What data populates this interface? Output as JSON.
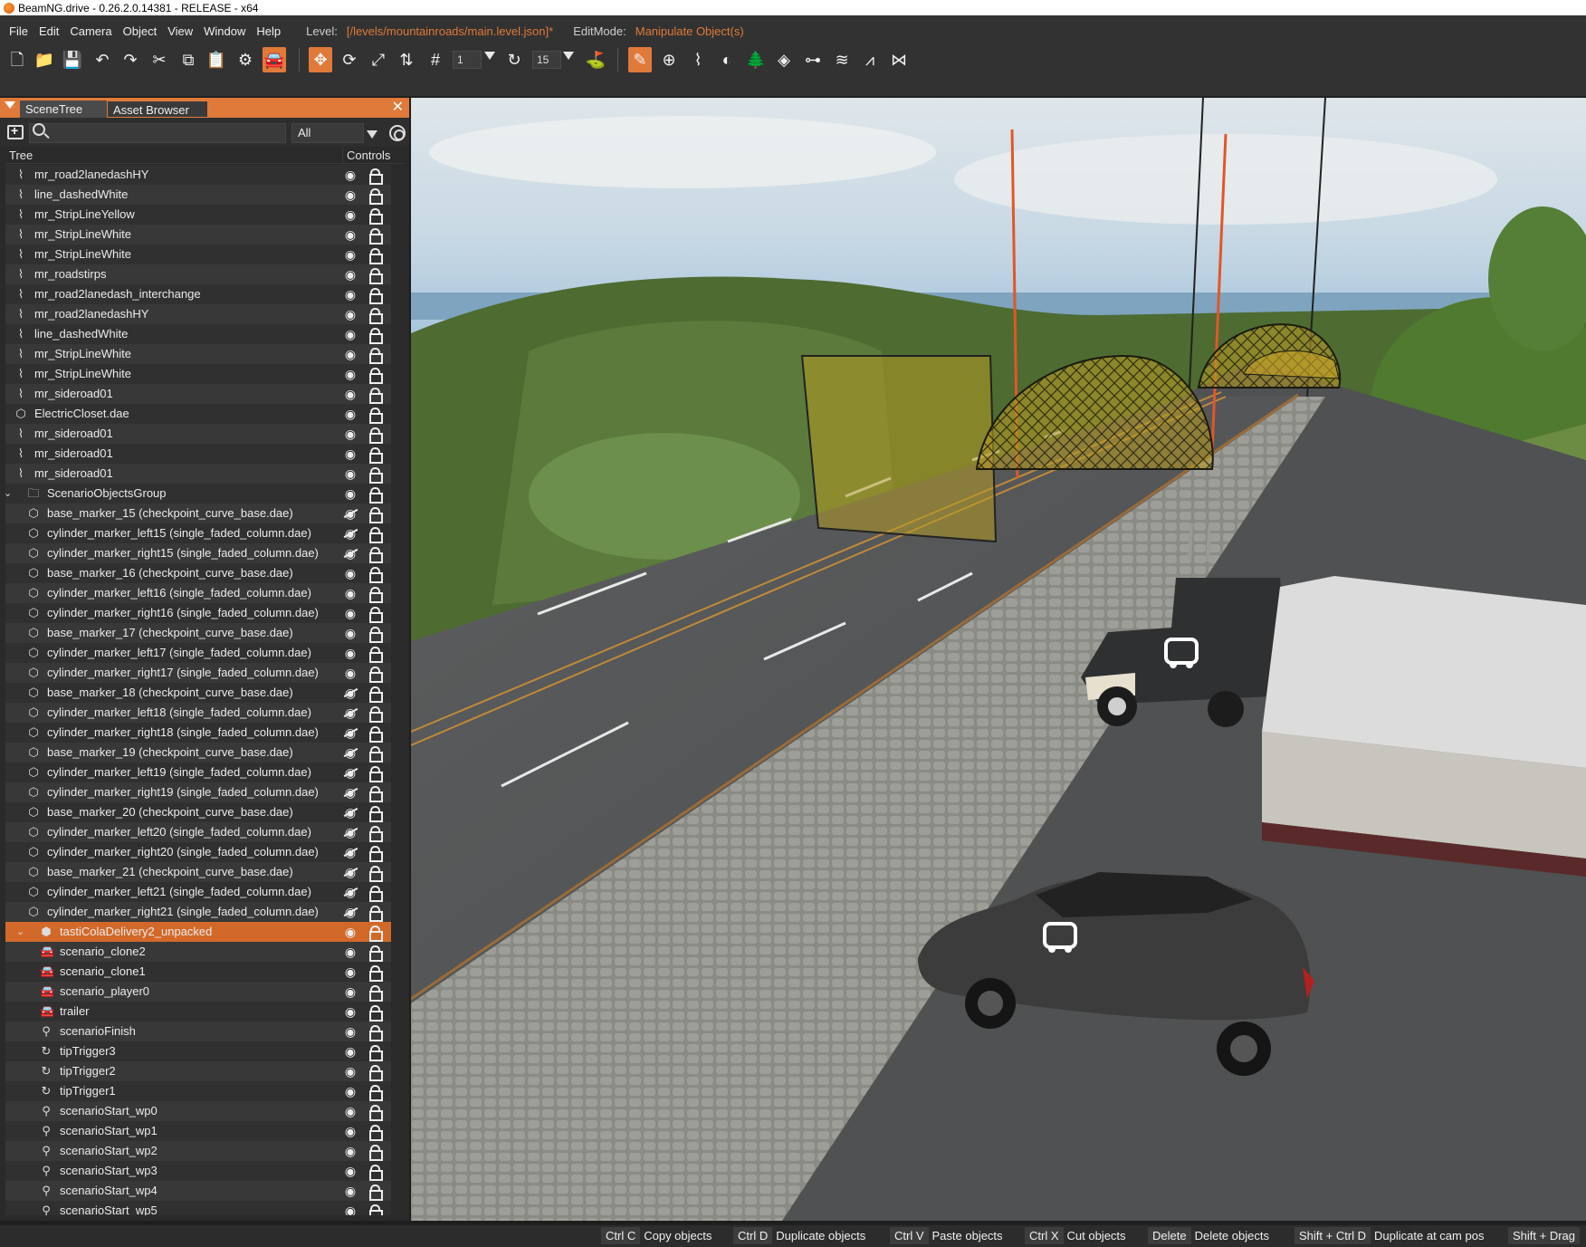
{
  "window": {
    "title": "BeamNG.drive - 0.26.2.0.14381 - RELEASE - x64"
  },
  "menu": {
    "items": [
      "File",
      "Edit",
      "Camera",
      "Object",
      "View",
      "Window",
      "Help"
    ],
    "level_label": "Level:",
    "level_value": "[/levels/mountainroads/main.level.json]*",
    "editmode_label": "EditMode:",
    "editmode_value": "Manipulate Object(s)"
  },
  "toolbar": {
    "grid_value": "1",
    "rotation_snap_value": "15",
    "accent_color": "#e07a3a"
  },
  "panel": {
    "tabs": [
      "SceneTree",
      "Asset Browser"
    ],
    "search": {
      "placeholder": "",
      "value": ""
    },
    "filter_value": "All",
    "header_tree": "Tree",
    "header_controls": "Controls"
  },
  "tree_rows": [
    {
      "label": "mr_road2lanedashHY",
      "icon": "road-icon",
      "hidden": false
    },
    {
      "label": "line_dashedWhite",
      "icon": "road-icon",
      "hidden": false
    },
    {
      "label": "mr_StripLineYellow",
      "icon": "road-icon",
      "hidden": false
    },
    {
      "label": "mr_StripLineWhite",
      "icon": "road-icon",
      "hidden": false
    },
    {
      "label": "mr_StripLineWhite",
      "icon": "road-icon",
      "hidden": false
    },
    {
      "label": "mr_roadstirps",
      "icon": "road-icon",
      "hidden": false
    },
    {
      "label": "mr_road2lanedash_interchange",
      "icon": "road-icon",
      "hidden": false
    },
    {
      "label": "mr_road2lanedashHY",
      "icon": "road-icon",
      "hidden": false
    },
    {
      "label": "line_dashedWhite",
      "icon": "road-icon",
      "hidden": false
    },
    {
      "label": "mr_StripLineWhite",
      "icon": "road-icon",
      "hidden": false
    },
    {
      "label": "mr_StripLineWhite",
      "icon": "road-icon",
      "hidden": false
    },
    {
      "label": "mr_sideroad01",
      "icon": "road-icon",
      "hidden": false
    },
    {
      "label": "ElectricCloset.dae",
      "icon": "mesh-icon",
      "hidden": false
    },
    {
      "label": "mr_sideroad01",
      "icon": "road-icon",
      "hidden": false
    },
    {
      "label": "mr_sideroad01",
      "icon": "road-icon",
      "hidden": false
    },
    {
      "label": "mr_sideroad01",
      "icon": "road-icon",
      "hidden": false
    },
    {
      "label": "ScenarioObjectsGroup",
      "icon": "folder-icon",
      "hidden": false,
      "group": true
    },
    {
      "label": "base_marker_15 (checkpoint_curve_base.dae)",
      "icon": "mesh-icon",
      "hidden": true,
      "child": true
    },
    {
      "label": "cylinder_marker_left15 (single_faded_column.dae)",
      "icon": "mesh-icon",
      "hidden": true,
      "child": true
    },
    {
      "label": "cylinder_marker_right15 (single_faded_column.dae)",
      "icon": "mesh-icon",
      "hidden": true,
      "child": true
    },
    {
      "label": "base_marker_16 (checkpoint_curve_base.dae)",
      "icon": "mesh-icon",
      "hidden": false,
      "child": true
    },
    {
      "label": "cylinder_marker_left16 (single_faded_column.dae)",
      "icon": "mesh-icon",
      "hidden": false,
      "child": true
    },
    {
      "label": "cylinder_marker_right16 (single_faded_column.dae)",
      "icon": "mesh-icon",
      "hidden": false,
      "child": true
    },
    {
      "label": "base_marker_17 (checkpoint_curve_base.dae)",
      "icon": "mesh-icon",
      "hidden": false,
      "child": true
    },
    {
      "label": "cylinder_marker_left17 (single_faded_column.dae)",
      "icon": "mesh-icon",
      "hidden": false,
      "child": true
    },
    {
      "label": "cylinder_marker_right17 (single_faded_column.dae)",
      "icon": "mesh-icon",
      "hidden": false,
      "child": true
    },
    {
      "label": "base_marker_18 (checkpoint_curve_base.dae)",
      "icon": "mesh-icon",
      "hidden": true,
      "child": true
    },
    {
      "label": "cylinder_marker_left18 (single_faded_column.dae)",
      "icon": "mesh-icon",
      "hidden": true,
      "child": true
    },
    {
      "label": "cylinder_marker_right18 (single_faded_column.dae)",
      "icon": "mesh-icon",
      "hidden": true,
      "child": true
    },
    {
      "label": "base_marker_19 (checkpoint_curve_base.dae)",
      "icon": "mesh-icon",
      "hidden": true,
      "child": true
    },
    {
      "label": "cylinder_marker_left19 (single_faded_column.dae)",
      "icon": "mesh-icon",
      "hidden": true,
      "child": true
    },
    {
      "label": "cylinder_marker_right19 (single_faded_column.dae)",
      "icon": "mesh-icon",
      "hidden": true,
      "child": true
    },
    {
      "label": "base_marker_20 (checkpoint_curve_base.dae)",
      "icon": "mesh-icon",
      "hidden": true,
      "child": true
    },
    {
      "label": "cylinder_marker_left20 (single_faded_column.dae)",
      "icon": "mesh-icon",
      "hidden": true,
      "child": true
    },
    {
      "label": "cylinder_marker_right20 (single_faded_column.dae)",
      "icon": "mesh-icon",
      "hidden": true,
      "child": true
    },
    {
      "label": "base_marker_21 (checkpoint_curve_base.dae)",
      "icon": "mesh-icon",
      "hidden": true,
      "child": true
    },
    {
      "label": "cylinder_marker_left21 (single_faded_column.dae)",
      "icon": "mesh-icon",
      "hidden": true,
      "child": true
    },
    {
      "label": "cylinder_marker_right21 (single_faded_column.dae)",
      "icon": "mesh-icon",
      "hidden": true,
      "child": true
    },
    {
      "label": "tastiColaDelivery2_unpacked",
      "icon": "prefab-icon",
      "hidden": false,
      "child": true,
      "group": true,
      "selected": true
    },
    {
      "label": "scenario_clone2",
      "icon": "car-icon",
      "hidden": false,
      "grandchild": true
    },
    {
      "label": "scenario_clone1",
      "icon": "car-icon",
      "hidden": false,
      "grandchild": true
    },
    {
      "label": "scenario_player0",
      "icon": "car-icon",
      "hidden": false,
      "grandchild": true
    },
    {
      "label": "trailer",
      "icon": "car-icon",
      "hidden": false,
      "grandchild": true
    },
    {
      "label": "scenarioFinish",
      "icon": "waypoint-icon",
      "hidden": false,
      "grandchild": true
    },
    {
      "label": "tipTrigger3",
      "icon": "trigger-icon",
      "hidden": false,
      "grandchild": true
    },
    {
      "label": "tipTrigger2",
      "icon": "trigger-icon",
      "hidden": false,
      "grandchild": true
    },
    {
      "label": "tipTrigger1",
      "icon": "trigger-icon",
      "hidden": false,
      "grandchild": true
    },
    {
      "label": "scenarioStart_wp0",
      "icon": "waypoint-icon",
      "hidden": false,
      "grandchild": true
    },
    {
      "label": "scenarioStart_wp1",
      "icon": "waypoint-icon",
      "hidden": false,
      "grandchild": true
    },
    {
      "label": "scenarioStart_wp2",
      "icon": "waypoint-icon",
      "hidden": false,
      "grandchild": true
    },
    {
      "label": "scenarioStart_wp3",
      "icon": "waypoint-icon",
      "hidden": false,
      "grandchild": true
    },
    {
      "label": "scenarioStart_wp4",
      "icon": "waypoint-icon",
      "hidden": false,
      "grandchild": true
    },
    {
      "label": "scenarioStart_wp5",
      "icon": "waypoint-icon",
      "hidden": false,
      "grandchild": true
    }
  ],
  "statusbar": [
    {
      "key": "Ctrl C",
      "desc": "Copy objects"
    },
    {
      "key": "Ctrl D",
      "desc": "Duplicate objects"
    },
    {
      "key": "Ctrl V",
      "desc": "Paste objects"
    },
    {
      "key": "Ctrl X",
      "desc": "Cut objects"
    },
    {
      "key": "Delete",
      "desc": "Delete objects"
    },
    {
      "key": "Shift + Ctrl D",
      "desc": "Duplicate at cam pos"
    },
    {
      "key": "Shift + Drag",
      "desc": ""
    }
  ]
}
